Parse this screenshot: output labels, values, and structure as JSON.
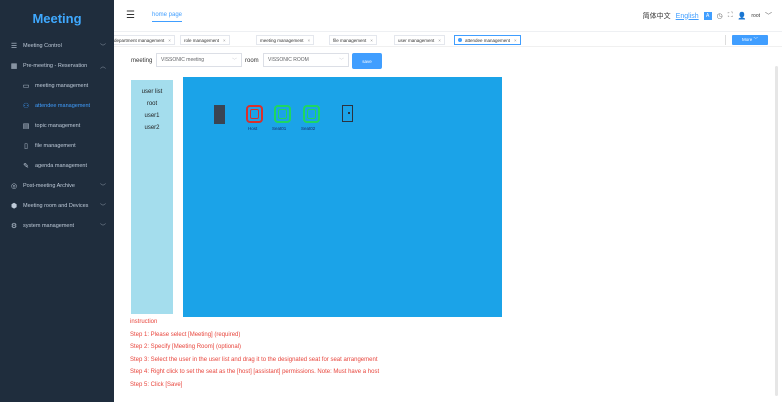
{
  "app": {
    "title": "Meeting"
  },
  "sidebar": {
    "items": [
      {
        "label": "Meeting Control",
        "icon": "sliders-icon",
        "chevron": "﹀"
      },
      {
        "label": "Pre-meeting - Reservation",
        "icon": "calendar-icon",
        "chevron": "︿"
      },
      {
        "label": "Post-meeting Archive",
        "icon": "archive-icon",
        "chevron": "﹀"
      },
      {
        "label": "Meeting room and Devices",
        "icon": "device-icon",
        "chevron": "﹀"
      },
      {
        "label": "system management",
        "icon": "settings-icon",
        "chevron": "﹀"
      }
    ],
    "submenu": [
      {
        "label": "meeting management",
        "icon": "meeting-icon"
      },
      {
        "label": "attendee management",
        "icon": "people-icon",
        "active": true
      },
      {
        "label": "topic management",
        "icon": "document-icon"
      },
      {
        "label": "file management",
        "icon": "file-icon"
      },
      {
        "label": "agenda management",
        "icon": "agenda-icon"
      }
    ]
  },
  "header": {
    "home_label": "home page",
    "lang_cn": "简体中文",
    "lang_en": "English",
    "square_glyph": "A",
    "username": "root"
  },
  "tags": {
    "items": [
      {
        "label": "department management"
      },
      {
        "label": "role management"
      },
      {
        "label": "meeting management"
      },
      {
        "label": "file management"
      },
      {
        "label": "user management"
      },
      {
        "label": "attendee management",
        "active": true
      }
    ],
    "close_glyph": "×",
    "more_label": "More ﹀"
  },
  "toolbar": {
    "meeting_label": "meeting",
    "meeting_value": "VISSONIC meeting",
    "room_label": "room",
    "room_value": "VISSONIC ROOM",
    "save_label": "save"
  },
  "userlist": {
    "title": "user list",
    "users": [
      "root",
      "user1",
      "user2"
    ]
  },
  "seats": {
    "host_label": "Host",
    "seat1_label": "Seat01",
    "seat2_label": "Seat02"
  },
  "instructions": {
    "title": "instruction",
    "steps": [
      "Step 1: Please select [Meeting] (required)",
      "Step 2: Specify [Meeting Room] (optional)",
      "Step 3: Select the user in the user list and drag it to the designated seat for seat arrangement",
      "Step 4: Right click to set the seat as the [host] [assistant] permissions. Note: Must have a host",
      "Step 5: Click [Save]"
    ]
  },
  "colors": {
    "sidebar_bg": "#1f2d3d",
    "accent": "#409eff",
    "canvas_bg": "#1ba3e8",
    "userlist_bg": "#a4dded",
    "host_seat": "#d9302c",
    "seat": "#1ed760",
    "instruction_text": "#e8453c"
  }
}
